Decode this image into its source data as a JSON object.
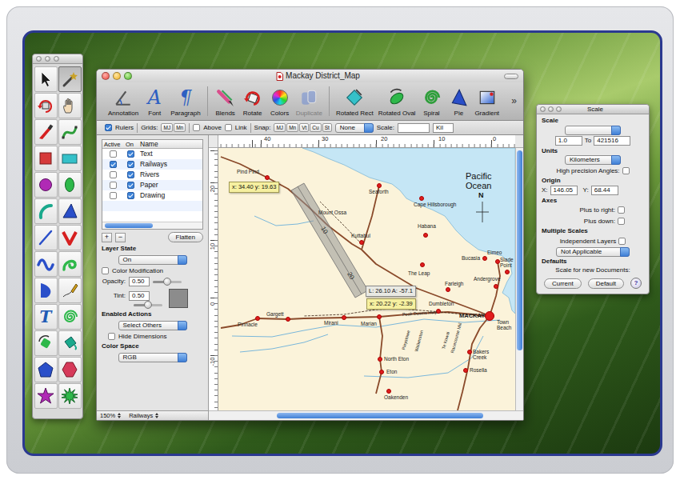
{
  "toolbox": {
    "tools": [
      {
        "kind": "pointer",
        "color": "#1a1a1a",
        "selected": false
      },
      {
        "kind": "wand",
        "color": "#c9a227",
        "selected": true
      },
      {
        "kind": "rotate",
        "color": "#d62020",
        "selected": false
      },
      {
        "kind": "hand",
        "color": "#555555",
        "selected": false
      },
      {
        "kind": "knife",
        "color": "#d62020",
        "selected": false
      },
      {
        "kind": "bezier",
        "color": "#2e9e3a",
        "selected": false
      },
      {
        "kind": "square",
        "color": "#d63a3a",
        "selected": false
      },
      {
        "kind": "rect",
        "color": "#35c1c9",
        "selected": false
      },
      {
        "kind": "circle",
        "color": "#b02ab5",
        "selected": false
      },
      {
        "kind": "oval",
        "color": "#2eb84a",
        "selected": false
      },
      {
        "kind": "arc",
        "color": "#1aa98c",
        "selected": false
      },
      {
        "kind": "triangle",
        "color": "#2a4fc9",
        "selected": false
      },
      {
        "kind": "line",
        "color": "#2a4fc9",
        "selected": false
      },
      {
        "kind": "vee",
        "color": "#d62020",
        "selected": false
      },
      {
        "kind": "wave",
        "color": "#2a4fc9",
        "selected": false
      },
      {
        "kind": "curl",
        "color": "#2eb84a",
        "selected": false
      },
      {
        "kind": "dee",
        "color": "#2a4fc9",
        "selected": false
      },
      {
        "kind": "pencil",
        "color": "#d4a017",
        "selected": false
      },
      {
        "kind": "text",
        "color": "#1f5bb5",
        "selected": false,
        "label": "T"
      },
      {
        "kind": "spiral",
        "color": "#2eb84a",
        "selected": false
      },
      {
        "kind": "rotshape",
        "color": "#2eb84a",
        "selected": false
      },
      {
        "kind": "bucket",
        "color": "#1aa98c",
        "selected": false
      },
      {
        "kind": "pentagon",
        "color": "#2a4fc9",
        "selected": false
      },
      {
        "kind": "hexagon",
        "color": "#d63a5a",
        "selected": false
      },
      {
        "kind": "star",
        "color": "#b02ab5",
        "selected": false
      },
      {
        "kind": "burst",
        "color": "#2eb84a",
        "selected": false
      }
    ]
  },
  "window": {
    "title": "Mackay District_Map"
  },
  "toolbar": {
    "buttons": [
      {
        "label": "Annotation",
        "kind": "annotation",
        "disabled": false
      },
      {
        "label": "Font",
        "kind": "font",
        "glyph": "A",
        "disabled": false
      },
      {
        "label": "Paragraph",
        "kind": "paragraph",
        "glyph": "¶",
        "disabled": false
      },
      {
        "label": "Blends",
        "kind": "blends",
        "disabled": false
      },
      {
        "label": "Rotate",
        "kind": "rotate",
        "disabled": false
      },
      {
        "label": "Colors",
        "kind": "colors",
        "disabled": false
      },
      {
        "label": "Duplicate",
        "kind": "duplicate",
        "disabled": true
      },
      {
        "label": "Rotated Rect",
        "kind": "rotrect",
        "disabled": false
      },
      {
        "label": "Rotated Oval",
        "kind": "rotoval",
        "disabled": false
      },
      {
        "label": "Spiral",
        "kind": "spiral",
        "disabled": false
      },
      {
        "label": "Pie",
        "kind": "pie",
        "disabled": false
      },
      {
        "label": "Gradient",
        "kind": "gradient",
        "disabled": false
      }
    ],
    "overflow": "»"
  },
  "options_bar": {
    "rulers": {
      "label": "Rulers",
      "checked": true
    },
    "grids": {
      "label": "Grids:",
      "buttons": [
        {
          "label": "MJ",
          "selected": false
        },
        {
          "label": "Mn",
          "selected": false
        }
      ]
    },
    "above": {
      "label": "Above",
      "checked": false
    },
    "link": {
      "label": "Link",
      "checked": false
    },
    "snap": {
      "label": "Snap:",
      "buttons": [
        {
          "label": "MJ",
          "selected": false
        },
        {
          "label": "Mn",
          "selected": false
        },
        {
          "label": "Vt",
          "selected": false
        },
        {
          "label": "Cu",
          "selected": false
        },
        {
          "label": "St",
          "selected": false
        }
      ]
    },
    "snap_mode": "None",
    "scale_label": "Scale:",
    "units": "Kil"
  },
  "layers": {
    "columns": [
      "Active",
      "On",
      "Name"
    ],
    "rows": [
      {
        "name": "Text",
        "active": false,
        "on": true,
        "selected": false
      },
      {
        "name": "Railways",
        "active": true,
        "on": true,
        "selected": false
      },
      {
        "name": "Rivers",
        "active": false,
        "on": true,
        "selected": false
      },
      {
        "name": "Paper",
        "active": false,
        "on": true,
        "selected": false
      },
      {
        "name": "Drawing",
        "active": false,
        "on": true,
        "selected": false
      }
    ]
  },
  "layer_panel": {
    "add": "+",
    "remove": "−",
    "flatten": "Flatten",
    "state_label": "Layer State",
    "state": "On",
    "color_mod": {
      "label": "Color Modification",
      "checked": false
    },
    "opacity": {
      "label": "Opacity:",
      "value": "0.50",
      "level": 0.5
    },
    "tint": {
      "label": "Tint:",
      "value": "0.50",
      "level": 0.5,
      "swatch": "#8c8c8c"
    },
    "actions_label": "Enabled Actions",
    "actions": "Select Others",
    "hide_dims": {
      "label": "Hide Dimensions",
      "checked": false
    },
    "color_space_label": "Color Space",
    "color_space": "RGB"
  },
  "status_bar": {
    "zoom": "150%",
    "layer": "Railways"
  },
  "rulers": {
    "top": [
      "40",
      "30",
      "20",
      "10",
      "0"
    ],
    "left": [
      "20",
      "10",
      "0",
      "-10"
    ]
  },
  "map": {
    "ocean": "Pacific Ocean",
    "north": "N",
    "places": [
      {
        "name": "Pind Pind",
        "kind": "town"
      },
      {
        "name": "Seaforth",
        "kind": "town"
      },
      {
        "name": "Cape Hillsborough",
        "kind": "town"
      },
      {
        "name": "Mount Ossa",
        "kind": "locality"
      },
      {
        "name": "Habana",
        "kind": "town"
      },
      {
        "name": "Kuttabul",
        "kind": "town"
      },
      {
        "name": "The Leap",
        "kind": "town"
      },
      {
        "name": "Farleigh",
        "kind": "town"
      },
      {
        "name": "Bucasia",
        "kind": "town"
      },
      {
        "name": "Eimeo",
        "kind": "town"
      },
      {
        "name": "Slade Point",
        "kind": "town"
      },
      {
        "name": "Andergrove",
        "kind": "town"
      },
      {
        "name": "Dumbleton",
        "kind": "town"
      },
      {
        "name": "MACKAY",
        "kind": "city"
      },
      {
        "name": "Town Beach",
        "kind": "locality"
      },
      {
        "name": "Gargett",
        "kind": "town"
      },
      {
        "name": "Pinnacle",
        "kind": "town"
      },
      {
        "name": "Mirani",
        "kind": "town"
      },
      {
        "name": "Marian",
        "kind": "town"
      },
      {
        "name": "North Eton",
        "kind": "town"
      },
      {
        "name": "Eton",
        "kind": "town"
      },
      {
        "name": "Bakers Creek",
        "kind": "town"
      },
      {
        "name": "Rosella",
        "kind": "town"
      },
      {
        "name": "Oakenden",
        "kind": "town"
      },
      {
        "name": "Pleystowe",
        "kind": "road"
      },
      {
        "name": "Walkerston",
        "kind": "road"
      },
      {
        "name": "Te Kowai",
        "kind": "road"
      },
      {
        "name": "Racecourse Mill",
        "kind": "road"
      },
      {
        "name": "Peak Downs Hwy",
        "kind": "road"
      }
    ],
    "measure": {
      "ticks": [
        "10",
        "20"
      ]
    },
    "tooltips": [
      {
        "text": "x: 34.40  y: 19.63",
        "kind": "point"
      },
      {
        "text": "L: 26.10  A: -57.1",
        "kind": "length"
      },
      {
        "text": "x: 20.22  y: -2.39",
        "kind": "point"
      }
    ]
  },
  "scale_panel": {
    "title": "Scale",
    "scale_label": "Scale",
    "from": "1.0",
    "to_label": "To",
    "to": "421516",
    "units_label": "Units",
    "units": "Kilometers",
    "high_precision": {
      "label": "High precision Angles:",
      "checked": false
    },
    "origin_label": "Origin",
    "x_label": "X:",
    "x": "146.05",
    "y_label": "Y:",
    "y": "68.44",
    "axes_label": "Axes",
    "plus_right": {
      "label": "Plus to right:",
      "checked": false
    },
    "plus_down": {
      "label": "Plus down:",
      "checked": false
    },
    "multiple_label": "Multiple Scales",
    "independent": {
      "label": "Independent Layers",
      "checked": false
    },
    "multiple_choice": "Not Applicable",
    "defaults_label": "Defaults",
    "defaults_note": "Scale for new Documents:",
    "buttons": [
      "Current",
      "Default"
    ],
    "help": "?"
  }
}
